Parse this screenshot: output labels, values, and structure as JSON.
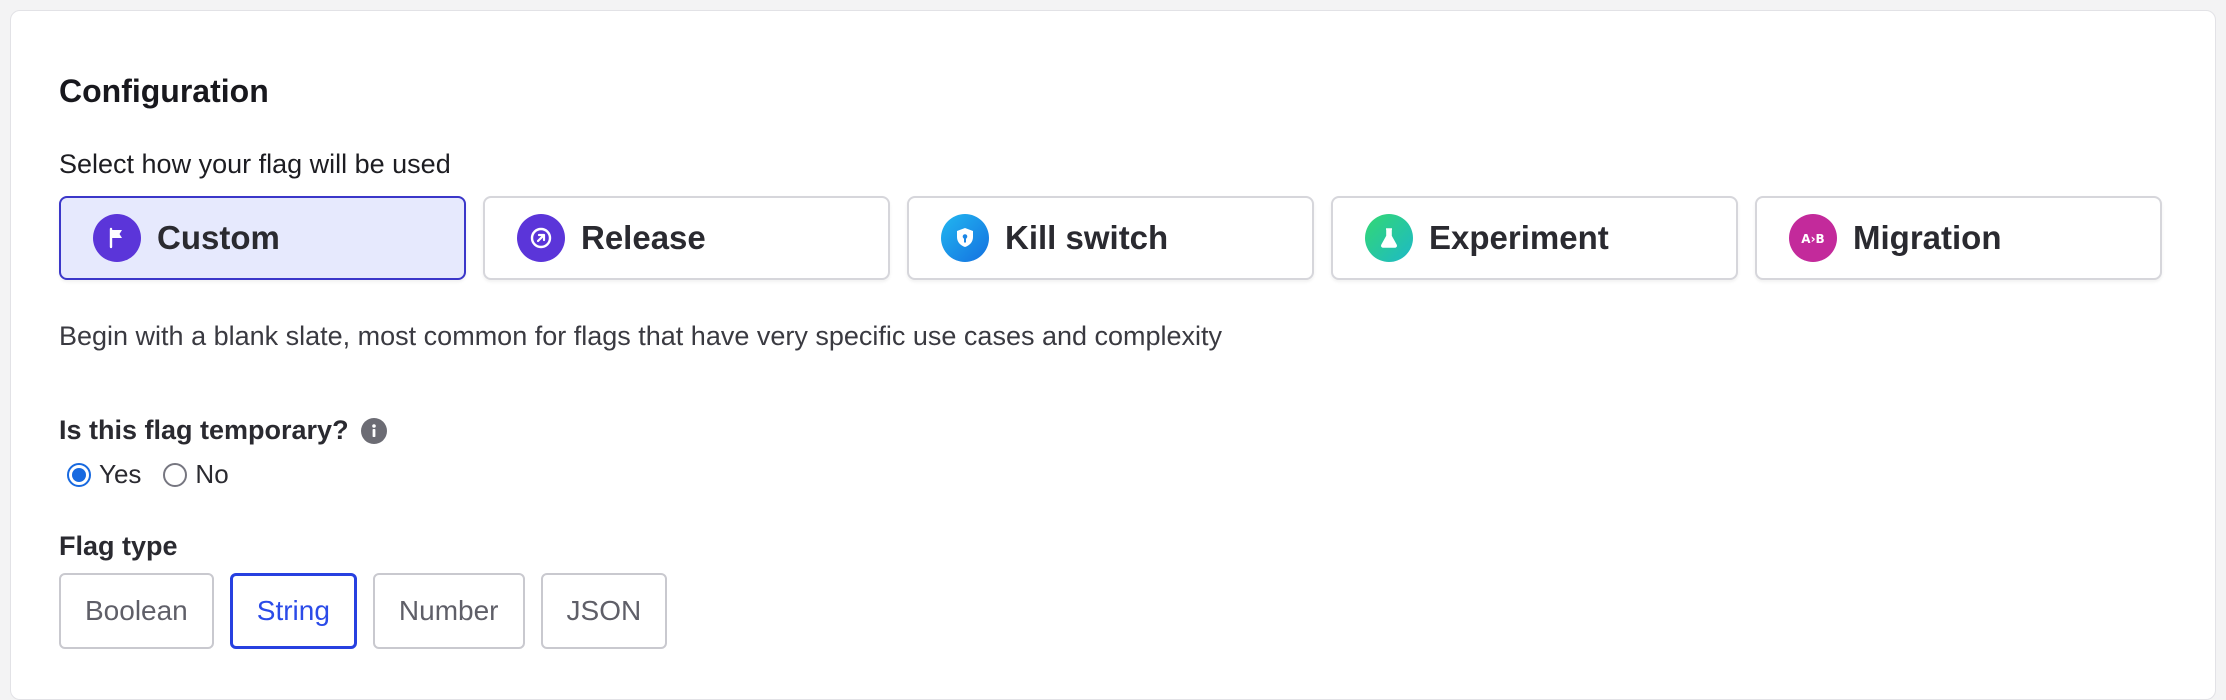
{
  "config": {
    "title": "Configuration",
    "subtitle": "Select how your flag will be used",
    "usecases": [
      {
        "label": "Custom",
        "icon": "flag-icon",
        "color": "#5b35d9",
        "selected": true
      },
      {
        "label": "Release",
        "icon": "arrow-up-right-icon",
        "color": "#5b35d9",
        "selected": false
      },
      {
        "label": "Kill switch",
        "icon": "shield-icon",
        "color": "#1593e6",
        "selected": false
      },
      {
        "label": "Experiment",
        "icon": "flask-icon",
        "color": "#28c98a",
        "selected": false
      },
      {
        "label": "Migration",
        "icon": "ab-icon",
        "color": "#c32a9b",
        "selected": false
      }
    ],
    "description": "Begin with a blank slate, most common for flags that have very specific use cases and complexity"
  },
  "temporary": {
    "label": "Is this flag temporary?",
    "options": [
      {
        "label": "Yes",
        "checked": true
      },
      {
        "label": "No",
        "checked": false
      }
    ]
  },
  "flag_type": {
    "label": "Flag type",
    "options": [
      {
        "label": "Boolean",
        "selected": false
      },
      {
        "label": "String",
        "selected": true
      },
      {
        "label": "Number",
        "selected": false
      },
      {
        "label": "JSON",
        "selected": false
      }
    ]
  },
  "colors": {
    "accent": "#2740e0",
    "selected_bg": "#e6e9fd",
    "radio": "#1769e0"
  }
}
